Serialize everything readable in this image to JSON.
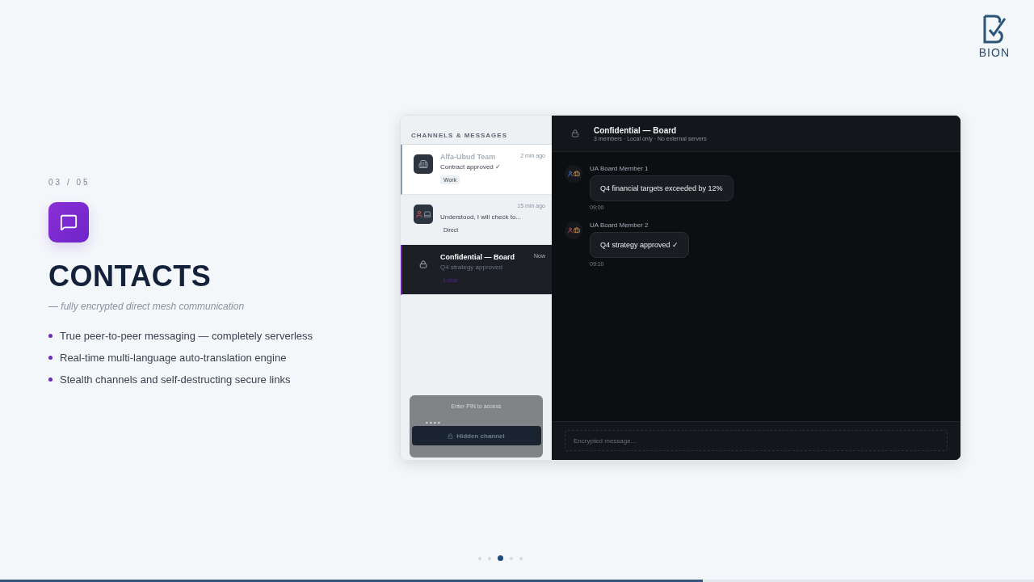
{
  "slide_counter": "03 / 05",
  "title": "CONTACTS",
  "subtitle": "— fully encrypted direct mesh communication",
  "bullets": [
    "True peer-to-peer messaging — completely serverless",
    "Real-time multi-language auto-translation engine",
    "Stealth channels and self-destructing secure links"
  ],
  "app": {
    "sidebar": {
      "heading": "CHANNELS & MESSAGES",
      "conversations": [
        {
          "kind": "team",
          "name": "Alfa-Ubud Team",
          "time": "2 min ago",
          "preview": "Contract approved ✓",
          "tag": "Work",
          "highlighted": true,
          "selected": false
        },
        {
          "kind": "direct",
          "time": "15 min ago",
          "preview": "Understood, I will check to...",
          "tag": "Direct",
          "highlighted": false,
          "selected": false
        },
        {
          "kind": "locked",
          "name": "Confidential — Board",
          "time": "Now",
          "preview": "Q4 strategy approved",
          "tag": "Local",
          "highlighted": false,
          "selected": true
        }
      ]
    },
    "hidden_channel": {
      "prompt": "Enter PIN to access",
      "pin": "• • • •",
      "label": "Hidden channel"
    },
    "chat": {
      "title": "Confidential — Board",
      "subtitle": "3 members · Local only · No external servers",
      "messages": [
        {
          "sender": "UA Board Member 1",
          "text": "Q4 financial targets exceeded by 12%",
          "time": "09:00"
        },
        {
          "sender": "UA Board Member 2",
          "text": "Q4 strategy approved ✓",
          "time": "09:10"
        }
      ]
    },
    "composer": {
      "placeholder": "Encrypted message..."
    }
  },
  "logo": {
    "text": "BION"
  },
  "pager": {
    "dots": [
      {
        "selected": false
      },
      {
        "selected": false
      },
      {
        "selected": true
      },
      {
        "selected": false
      },
      {
        "selected": false
      }
    ]
  },
  "progress": {
    "level": 0.68
  }
}
